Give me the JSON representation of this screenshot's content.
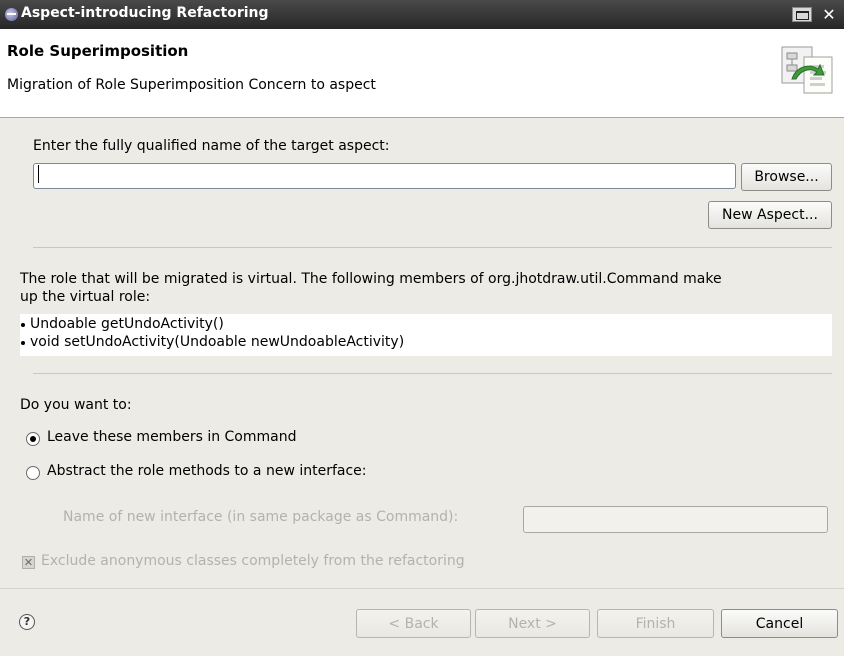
{
  "window": {
    "title": "Aspect-introducing Refactoring",
    "close_glyph": "✕"
  },
  "header": {
    "title": "Role Superimposition",
    "description": "Migration of Role Superimposition Concern to aspect"
  },
  "target": {
    "label": "Enter the fully qualified name of the target aspect:",
    "value": "",
    "browse_label": "Browse...",
    "new_aspect_label": "New Aspect..."
  },
  "role": {
    "line1": "The role that will be migrated is virtual. The following members of org.jhotdraw.util.Command make",
    "line2": "up the virtual role:",
    "members": [
      "Undoable getUndoActivity()",
      "void setUndoActivity(Undoable newUndoableActivity)"
    ]
  },
  "options": {
    "question": "Do you want to:",
    "choices": [
      {
        "label": "Leave these members in Command",
        "selected": true
      },
      {
        "label": "Abstract the role methods to a new interface:",
        "selected": false
      }
    ],
    "interface_label": "Name of new interface (in same package as Command):",
    "interface_value": "",
    "exclude_label": "Exclude anonymous classes completely from the refactoring",
    "exclude_checked": true
  },
  "footer": {
    "help_glyph": "?",
    "back_label": "< Back",
    "next_label": "Next >",
    "finish_label": "Finish",
    "cancel_label": "Cancel"
  },
  "icons": {
    "window": "eclipse-icon",
    "banner": "refactoring-wizard-banner-icon",
    "help": "help-icon"
  }
}
